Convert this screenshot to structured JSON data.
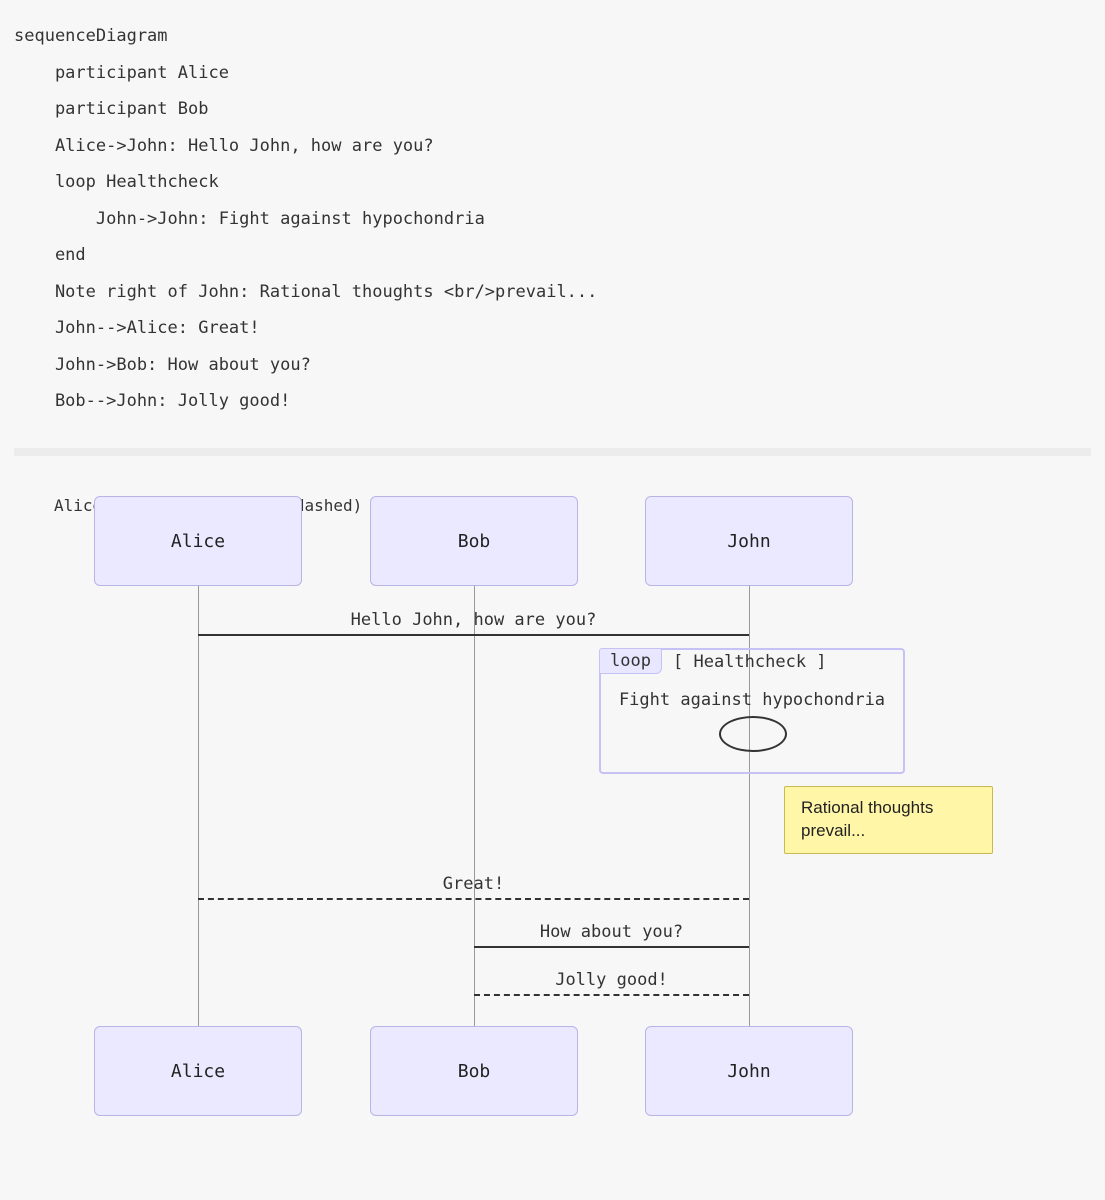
{
  "code_lines": [
    "sequenceDiagram",
    "    participant Alice",
    "    participant Bob",
    "    Alice->John: Hello John, how are you?",
    "    loop Healthcheck",
    "        John->John: Fight against hypochondria",
    "    end",
    "    Note right of John: Rational thoughts <br/>prevail...",
    "    John-->Alice: Great!",
    "    John->Bob: How about you?",
    "    Bob-->John: Jolly good!"
  ],
  "participants": {
    "alice": "Alice",
    "bob": "Bob",
    "john": "John"
  },
  "messages": {
    "m1": "Hello John, how are you?",
    "m2": "Great!",
    "m3": "How about you?",
    "m4": "Jolly good!"
  },
  "loop": {
    "tag": "loop",
    "title": "[ Healthcheck ]",
    "msg": "Fight against hypochondria"
  },
  "note": {
    "line1": "Rational thoughts",
    "line2": "prevail..."
  },
  "chart_data": {
    "type": "sequence",
    "participants": [
      "Alice",
      "Bob",
      "John"
    ],
    "steps": [
      {
        "kind": "message",
        "from": "Alice",
        "to": "John",
        "text": "Hello John, how are you?",
        "style": "solid"
      },
      {
        "kind": "loop",
        "label": "Healthcheck",
        "steps": [
          {
            "kind": "message",
            "from": "John",
            "to": "John",
            "text": "Fight against hypochondria",
            "style": "solid"
          }
        ]
      },
      {
        "kind": "note",
        "of": "John",
        "side": "right",
        "text": "Rational thoughts prevail..."
      },
      {
        "kind": "message",
        "from": "John",
        "to": "Alice",
        "text": "Great!",
        "style": "dashed"
      },
      {
        "kind": "message",
        "from": "John",
        "to": "Bob",
        "text": "How about you?",
        "style": "solid"
      },
      {
        "kind": "message",
        "from": "Bob",
        "to": "John",
        "text": "Jolly good!",
        "style": "dashed"
      }
    ]
  }
}
